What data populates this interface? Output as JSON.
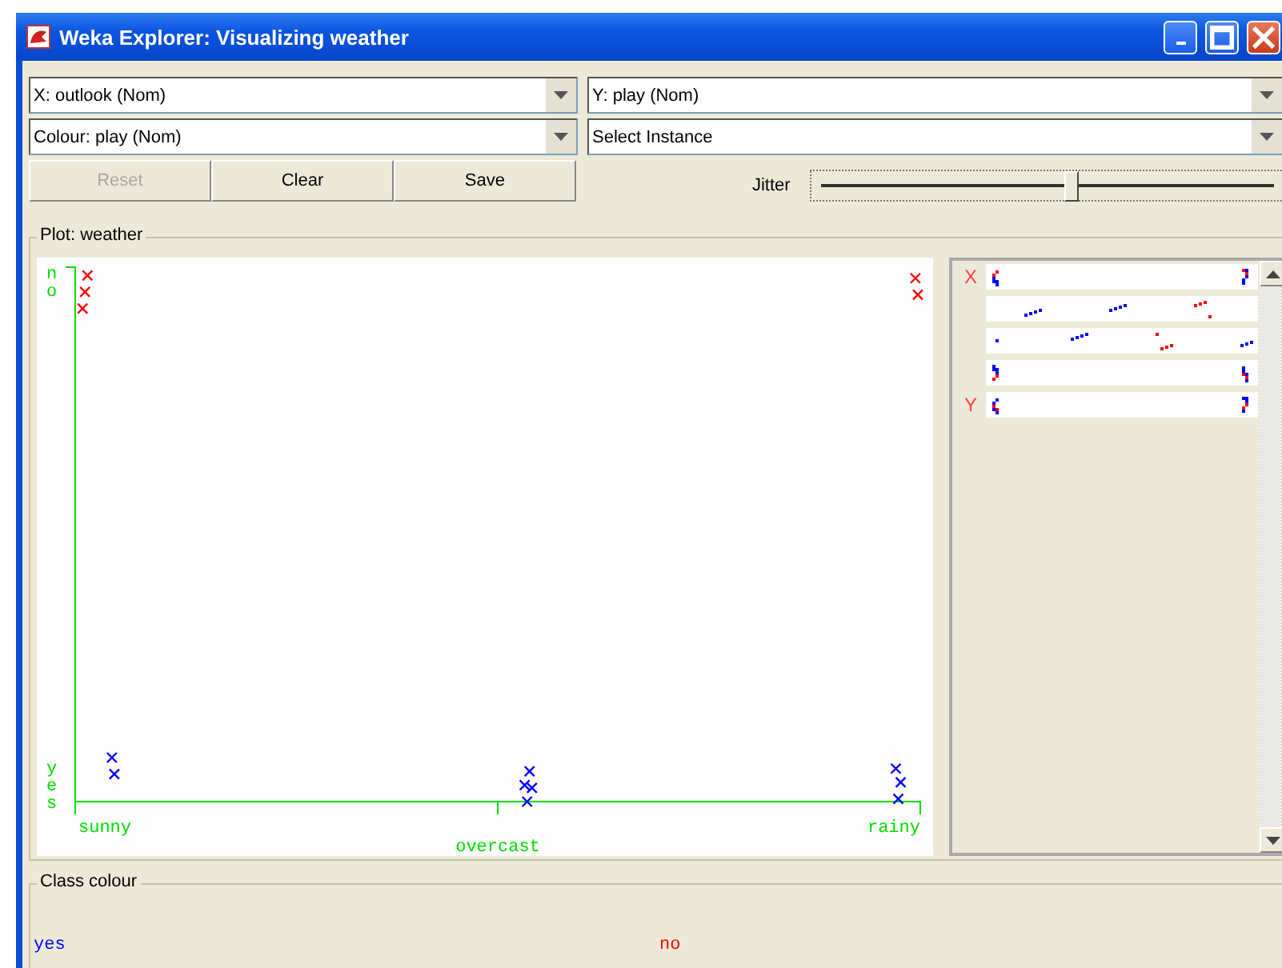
{
  "window": {
    "title": "Weka Explorer: Visualizing weather"
  },
  "selectors": [
    {
      "value": "X: outlook (Nom)"
    },
    {
      "value": "Y: play (Nom)"
    },
    {
      "value": "Colour: play (Nom)"
    },
    {
      "value": "Select Instance"
    }
  ],
  "buttons": [
    {
      "label": "Reset",
      "disabled": true
    },
    {
      "label": "Clear",
      "disabled": false
    },
    {
      "label": "Save",
      "disabled": false
    }
  ],
  "jitter": {
    "label": "Jitter",
    "level": 0.55
  },
  "plot": {
    "title": "Plot: weather",
    "x_labels": [
      "sunny",
      "overcast",
      "rainy"
    ],
    "y_labels": [
      "no",
      "yes"
    ]
  },
  "attribute_strips": [
    {
      "kind": "strip",
      "label": "X"
    },
    {
      "kind": "strip"
    },
    {
      "kind": "strip"
    },
    {
      "kind": "strip"
    },
    {
      "kind": "strip",
      "label": "Y"
    }
  ],
  "class_colour": {
    "title": "Class colour",
    "items": [
      {
        "label": "yes",
        "color": "#0000ff"
      },
      {
        "label": "no",
        "color": "#ff0000"
      }
    ]
  }
}
